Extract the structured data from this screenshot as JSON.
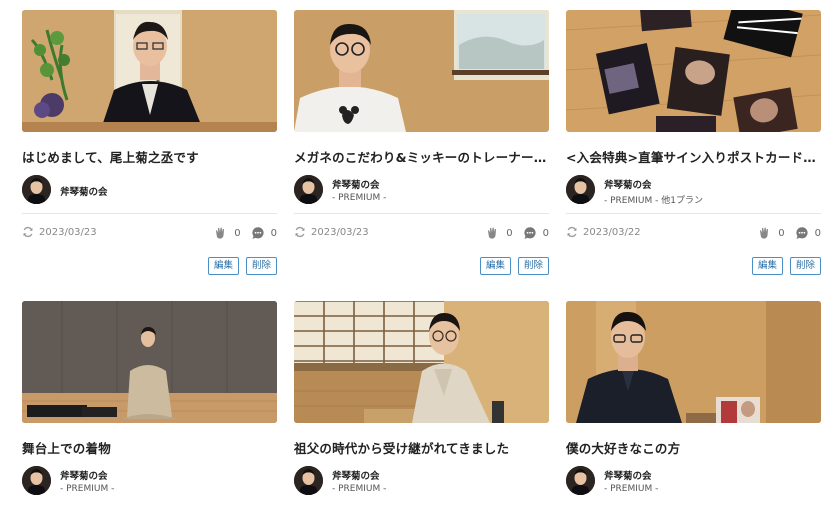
{
  "author": {
    "name": "斧琴菊の会"
  },
  "cards": [
    {
      "title": "はじめまして、尾上菊之丞です",
      "plan": "",
      "date": "2023/03/23",
      "claps": "0",
      "comments": "0",
      "edit_label": "編集",
      "delete_label": "削除"
    },
    {
      "title": "メガネのこだわり&ミッキーのトレーナー実は…",
      "plan": "- PREMIUM -",
      "date": "2023/03/23",
      "claps": "0",
      "comments": "0",
      "edit_label": "編集",
      "delete_label": "削除"
    },
    {
      "title": "<入会特典>直筆サイン入りポストカードを準…",
      "plan": "- PREMIUM - 他1プラン",
      "date": "2023/03/22",
      "claps": "0",
      "comments": "0",
      "edit_label": "編集",
      "delete_label": "削除"
    },
    {
      "title": "舞台上での着物",
      "plan": "- PREMIUM -"
    },
    {
      "title": "祖父の時代から受け継がれてきました",
      "plan": "- PREMIUM -"
    },
    {
      "title": "僕の大好きなこの方",
      "plan": "- PREMIUM -"
    }
  ],
  "icons": {
    "refresh": "refresh-icon",
    "clap": "clap-icon",
    "comment": "comment-icon"
  }
}
